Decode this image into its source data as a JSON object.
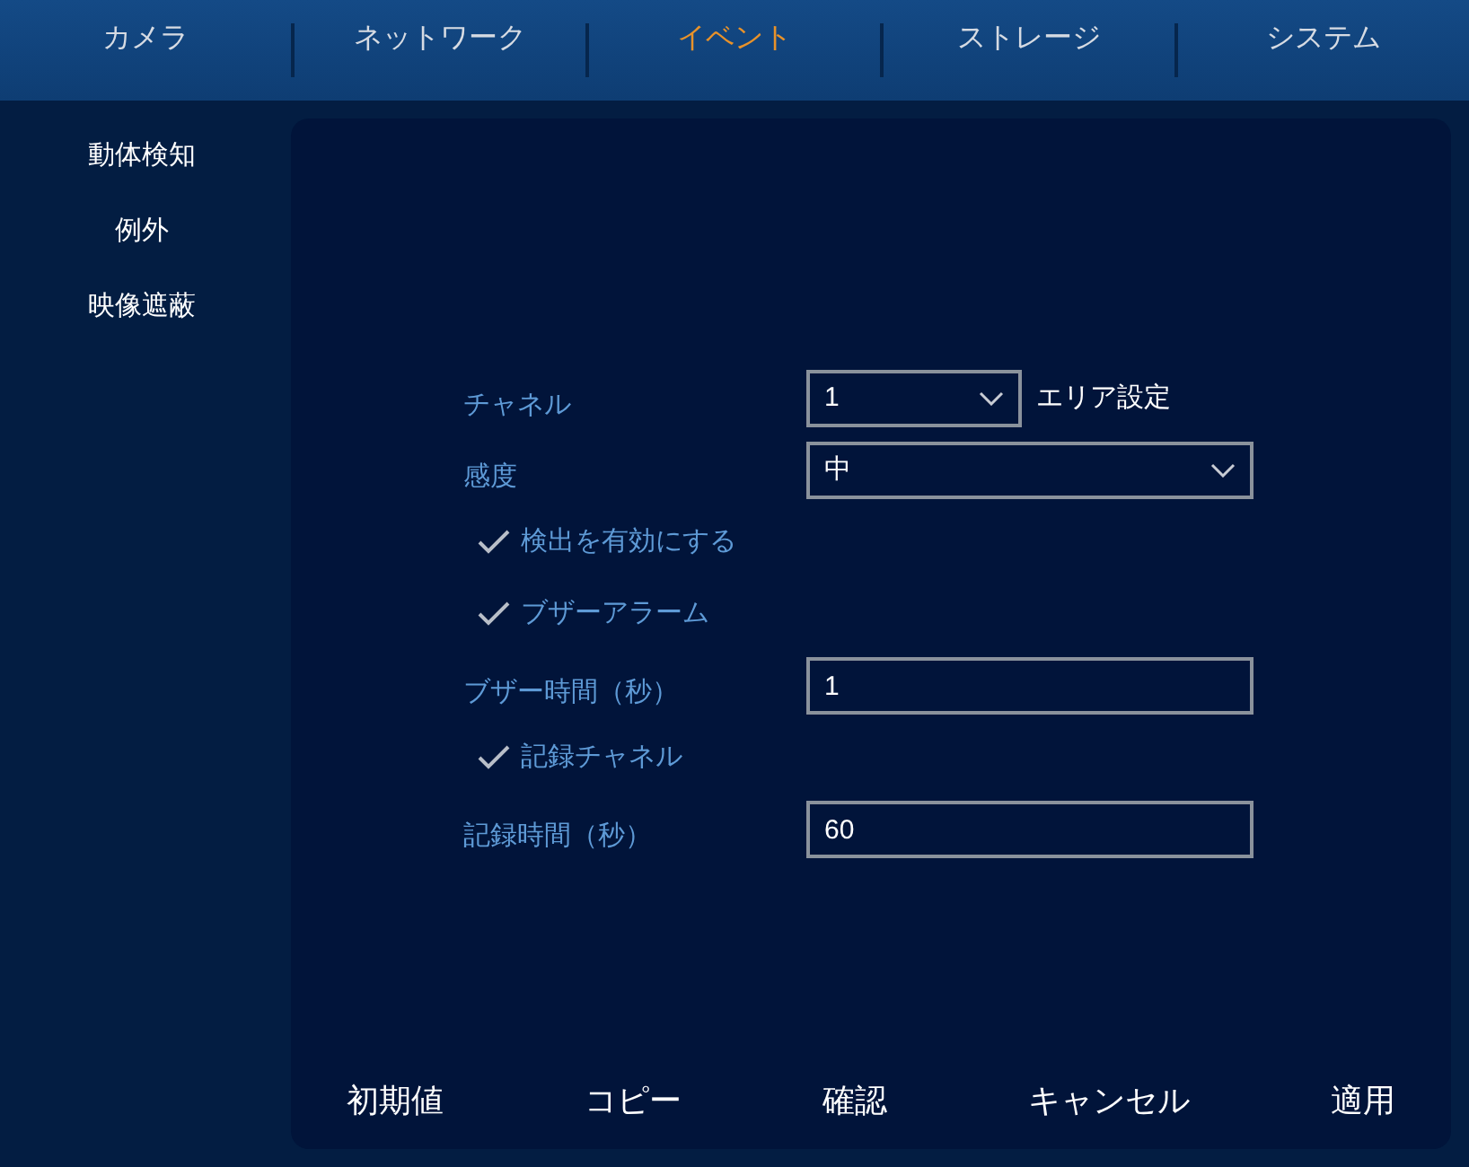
{
  "tabs": [
    {
      "label": "カメラ",
      "selected": false
    },
    {
      "label": "ネットワーク",
      "selected": false
    },
    {
      "label": "イベント",
      "selected": true
    },
    {
      "label": "ストレージ",
      "selected": false
    },
    {
      "label": "システム",
      "selected": false
    }
  ],
  "sidebar": {
    "items": [
      "動体検知",
      "例外",
      "映像遮蔽"
    ]
  },
  "form": [
    {
      "kind": "select",
      "label": "チャネル",
      "value": "1",
      "side_text": "エリア設定"
    },
    {
      "kind": "select",
      "label": "感度",
      "value": "中"
    },
    {
      "kind": "check",
      "label": "検出を有効にする",
      "checked": true
    },
    {
      "kind": "check",
      "label": "ブザーアラーム",
      "checked": true
    },
    {
      "kind": "input",
      "label": "ブザー時間（秒）",
      "value": "1"
    },
    {
      "kind": "check",
      "label": "記録チャネル",
      "checked": true
    },
    {
      "kind": "input",
      "label": "記録時間（秒）",
      "value": "60"
    }
  ],
  "buttons": [
    "初期値",
    "コピー",
    "確認",
    "キャンセル",
    "適用"
  ]
}
